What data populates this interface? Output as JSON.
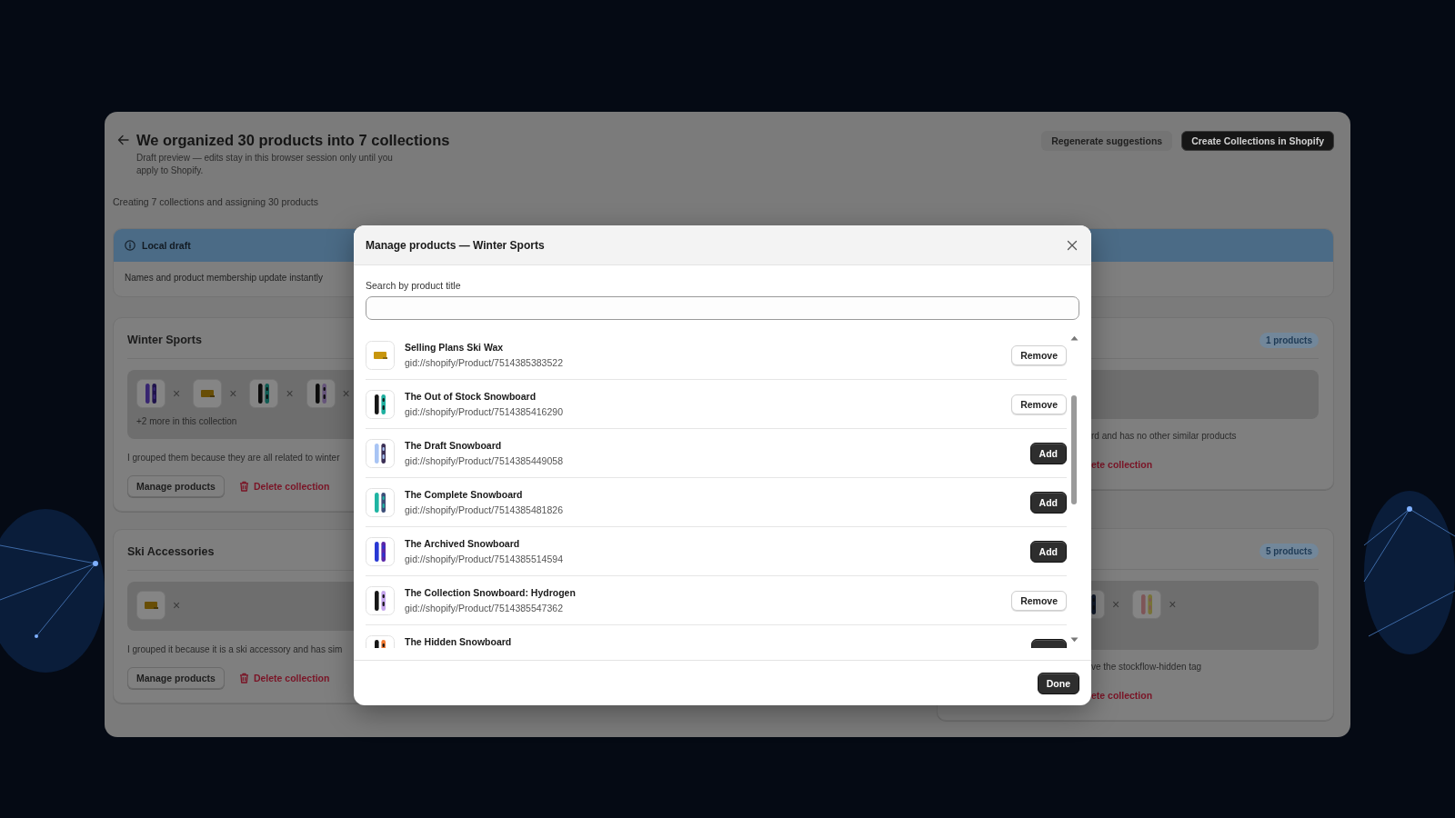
{
  "header": {
    "title": "We organized 30 products into 7 collections",
    "subtitle": "Draft preview — edits stay in this browser session only until you apply to Shopify.",
    "actions": [
      {
        "label": "Regenerate suggestions",
        "kind": "secondary"
      },
      {
        "label": "Create Collections in Shopify",
        "kind": "primary"
      }
    ]
  },
  "progress_text": "Creating 7 collections and assigning 30 products",
  "banner": {
    "title": "Local draft",
    "text": "Names and product membership update instantly"
  },
  "collections": {
    "left_column": [
      {
        "title": "Winter Sports",
        "thumbnails": [
          {
            "kind": "picture",
            "remove": "×"
          },
          {
            "kind": "picture",
            "remove": "×"
          },
          {
            "kind": "picture",
            "remove": "×"
          },
          {
            "kind": "picture",
            "remove": "×"
          }
        ],
        "more": "+2 more in this collection",
        "description": "I grouped them because they are all related to winter",
        "manage_label": "Manage products",
        "delete_label": "Delete collection"
      },
      {
        "title": "Ski Accessories",
        "thumbnails": [
          {
            "kind": "picture",
            "remove": "×"
          }
        ],
        "description": "I grouped it because it is a ski accessory and has sim",
        "manage_label": "Manage products",
        "delete_label": "Delete collection"
      }
    ],
    "right_column": [
      {
        "badge": "1 products",
        "description": "rd and has no other similar products",
        "delete_label": "ete collection"
      },
      {
        "badge": "5 products",
        "thumbnails": [
          {
            "kind": "picture",
            "remove": "×"
          },
          {
            "kind": "picture",
            "remove": "×"
          }
        ],
        "description": "ve the stockflow-hidden tag",
        "delete_label": "ete collection"
      }
    ]
  },
  "modal": {
    "title": "Manage products — Winter Sports",
    "search": {
      "label": "Search by product title"
    },
    "products": [
      {
        "title": "Selling Plans Ski Wax",
        "id": "gid://shopify/Product/7514385383522",
        "in_collection": true,
        "action": "Remove"
      },
      {
        "title": "The Out of Stock Snowboard",
        "id": "gid://shopify/Product/7514385416290",
        "in_collection": true,
        "action": "Remove"
      },
      {
        "title": "The Draft Snowboard",
        "id": "gid://shopify/Product/7514385449058",
        "in_collection": false,
        "action": "Add"
      },
      {
        "title": "The Complete Snowboard",
        "id": "gid://shopify/Product/7514385481826",
        "in_collection": false,
        "action": "Add"
      },
      {
        "title": "The Archived Snowboard",
        "id": "gid://shopify/Product/7514385514594",
        "in_collection": false,
        "action": "Add"
      },
      {
        "title": "The Collection Snowboard: Hydrogen",
        "id": "gid://shopify/Product/7514385547362",
        "in_collection": true,
        "action": "Remove"
      },
      {
        "title": "The Hidden Snowboard",
        "in_collection": false
      }
    ],
    "done_label": "Done"
  }
}
